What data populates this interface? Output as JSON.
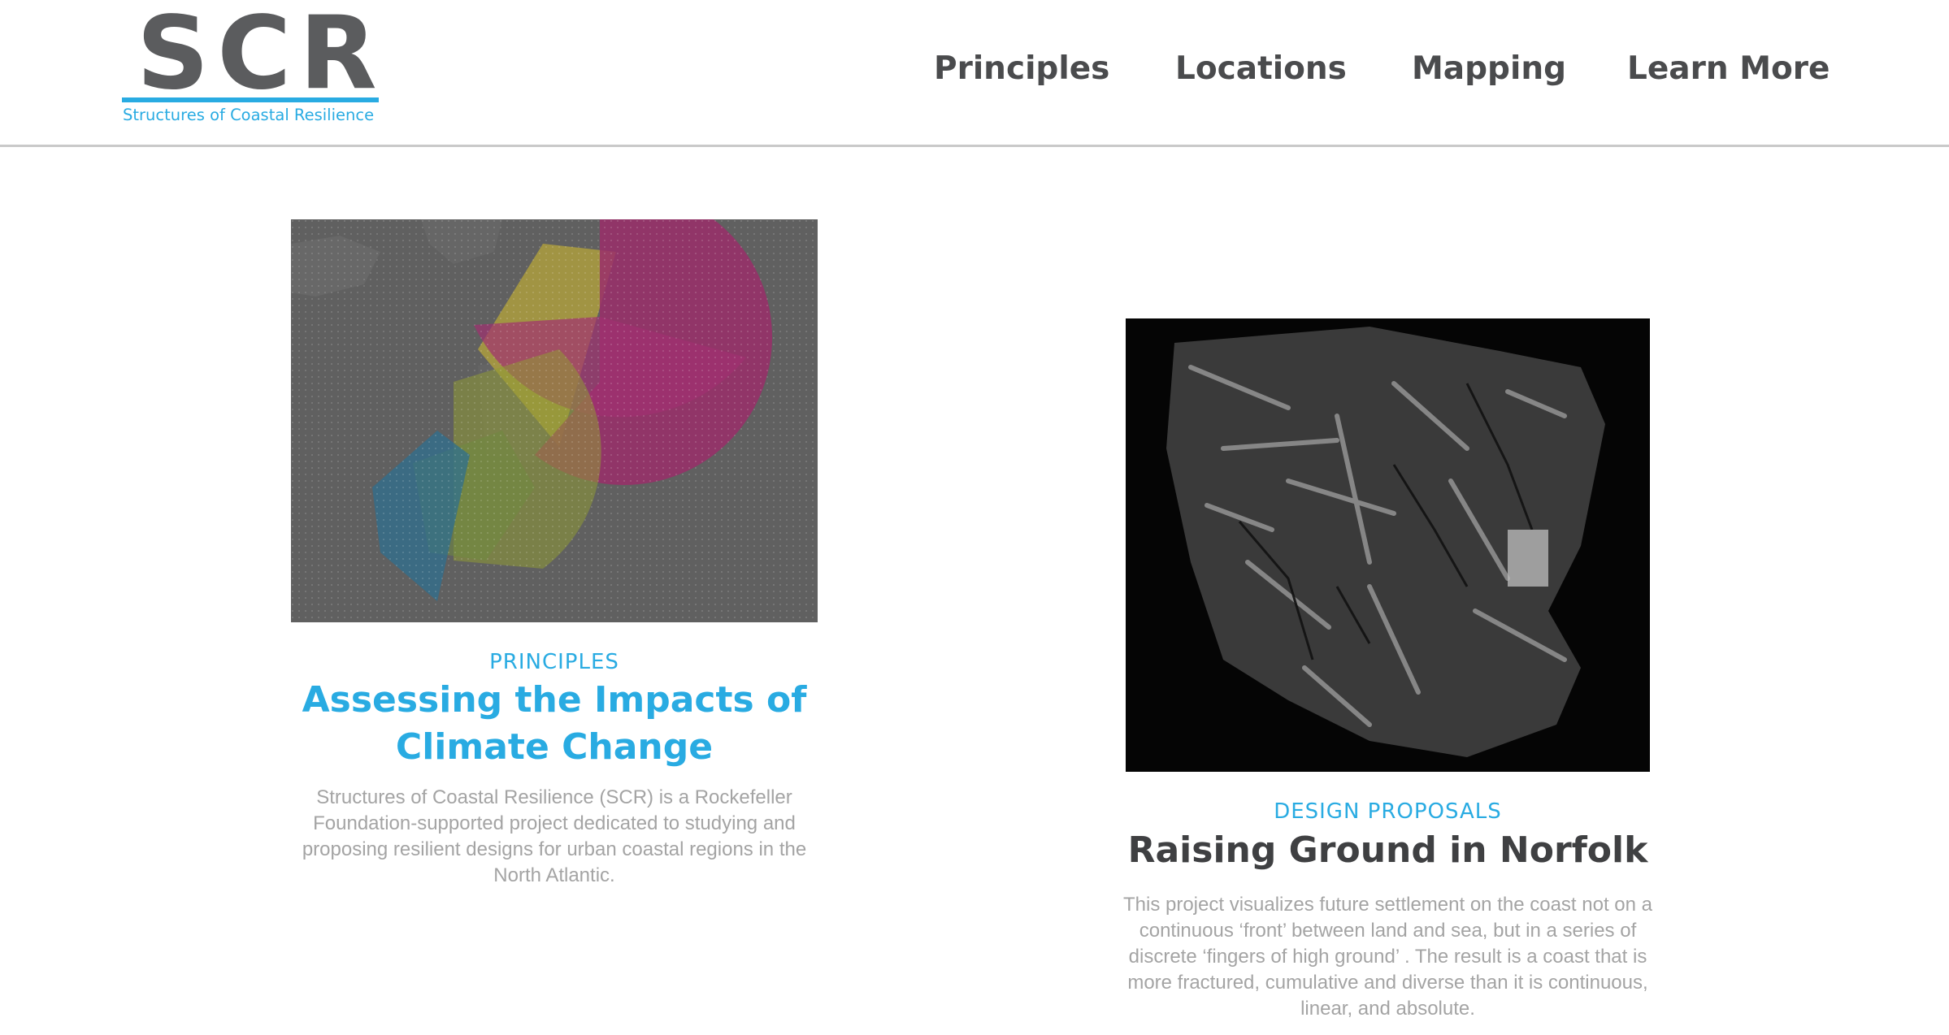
{
  "header": {
    "logo_text": "SCR",
    "logo_subtitle": "Structures of Coastal Resilience",
    "nav": [
      {
        "label": "Principles"
      },
      {
        "label": "Locations"
      },
      {
        "label": "Mapping"
      },
      {
        "label": "Learn More"
      }
    ]
  },
  "colors": {
    "accent": "#29abe2",
    "nav_text": "#4a4b4d",
    "body_text": "#a4a4a4"
  },
  "cards": [
    {
      "category": "PRINCIPLES",
      "title_line1": "Assessing the Impacts of",
      "title_line2": "Climate Change",
      "description": "Structures of Coastal Resilience (SCR) is a Rockefeller Foundation-supported project dedicated to studying and proposing resilient designs for urban coastal regions in the North Atlantic."
    },
    {
      "category": "DESIGN PROPOSALS",
      "title": "Raising Ground in Norfolk",
      "description": "This project visualizes future settlement on the coast not on a continuous ‘front’ between land and sea, but in a series of discrete ‘fingers of high ground’ . The result is a coast that is more fractured, cumulative and diverse than it is continuous, linear, and absolute."
    }
  ]
}
